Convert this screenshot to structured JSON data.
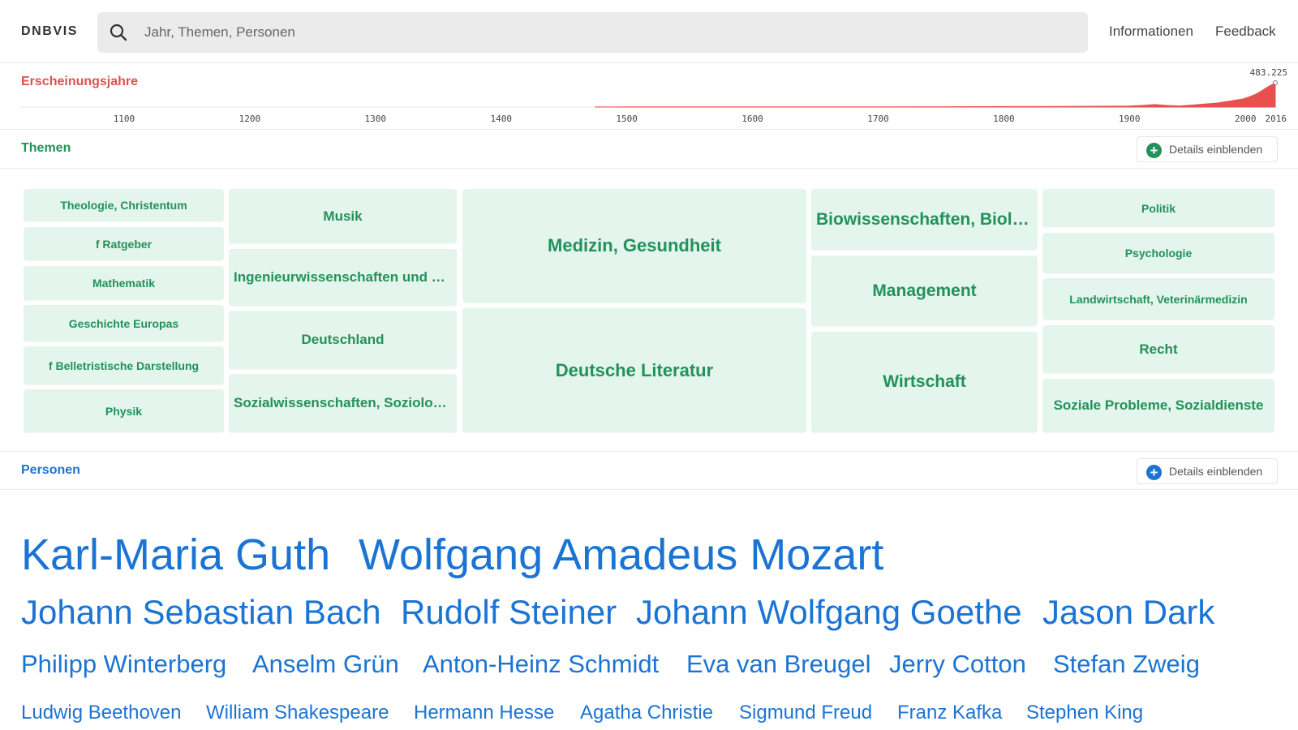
{
  "header": {
    "logo": "DNBVIS",
    "search_placeholder": "Jahr, Themen, Personen",
    "nav": [
      "Informationen",
      "Feedback"
    ]
  },
  "timeline": {
    "title": "Erscheinungsjahre",
    "max_label": "483.225",
    "chart_data": {
      "type": "area",
      "title": "Erscheinungsjahre",
      "x_ticks": [
        "1100",
        "1200",
        "1300",
        "1400",
        "1500",
        "1600",
        "1700",
        "1800",
        "1900",
        "2000",
        "2016"
      ],
      "xlim": [
        1040,
        2016
      ],
      "ylim": [
        0,
        483225
      ],
      "max_value": 483225,
      "series": [
        {
          "x": [
            1475,
            1500,
            1550,
            1600,
            1650,
            1700,
            1750,
            1800,
            1850,
            1900,
            1910,
            1920,
            1930,
            1940,
            1950,
            1960,
            1970,
            1975,
            1980,
            1985,
            1990,
            1995,
            2000,
            2005,
            2010,
            2016
          ],
          "y": [
            1000,
            2500,
            3500,
            4000,
            5000,
            5500,
            7000,
            9000,
            12000,
            20000,
            32000,
            50000,
            32000,
            22000,
            40000,
            60000,
            80000,
            100000,
            120000,
            140000,
            160000,
            200000,
            250000,
            320000,
            400000,
            483225
          ]
        }
      ],
      "color": "#e8504f"
    }
  },
  "themes": {
    "title": "Themen",
    "details_label": "Details einblenden",
    "accent": "#23915a",
    "tiles": [
      "Theologie, Christentum",
      "f Ratgeber",
      "Mathematik",
      "Geschichte Europas",
      "f Belletristische Darstellung",
      "Physik",
      "Musik",
      "Ingenieurwissenschaften und Maschinenbau",
      "Deutschland",
      "Sozialwissenschaften, Soziologie",
      "Medizin, Gesundheit",
      "Deutsche Literatur",
      "Biowissenschaften, Biologie",
      "Management",
      "Wirtschaft",
      "Politik",
      "Psychologie",
      "Landwirtschaft, Veterinärmedizin",
      "Recht",
      "Soziale Probleme, Sozialdienste"
    ]
  },
  "persons": {
    "title": "Personen",
    "details_label": "Details einblenden",
    "accent": "#1b74d4",
    "names": [
      "Karl-Maria Guth",
      "Wolfgang Amadeus Mozart",
      "Johann Sebastian Bach",
      "Rudolf Steiner",
      "Johann Wolfgang Goethe",
      "Jason Dark",
      "Philipp Winterberg",
      "Anselm Grün",
      "Anton-Heinz Schmidt",
      "Eva van Breugel",
      "Jerry Cotton",
      "Stefan Zweig",
      "Ludwig Beethoven",
      "William Shakespeare",
      "Hermann Hesse",
      "Agatha Christie",
      "Sigmund Freud",
      "Franz Kafka",
      "Stephen King"
    ]
  }
}
